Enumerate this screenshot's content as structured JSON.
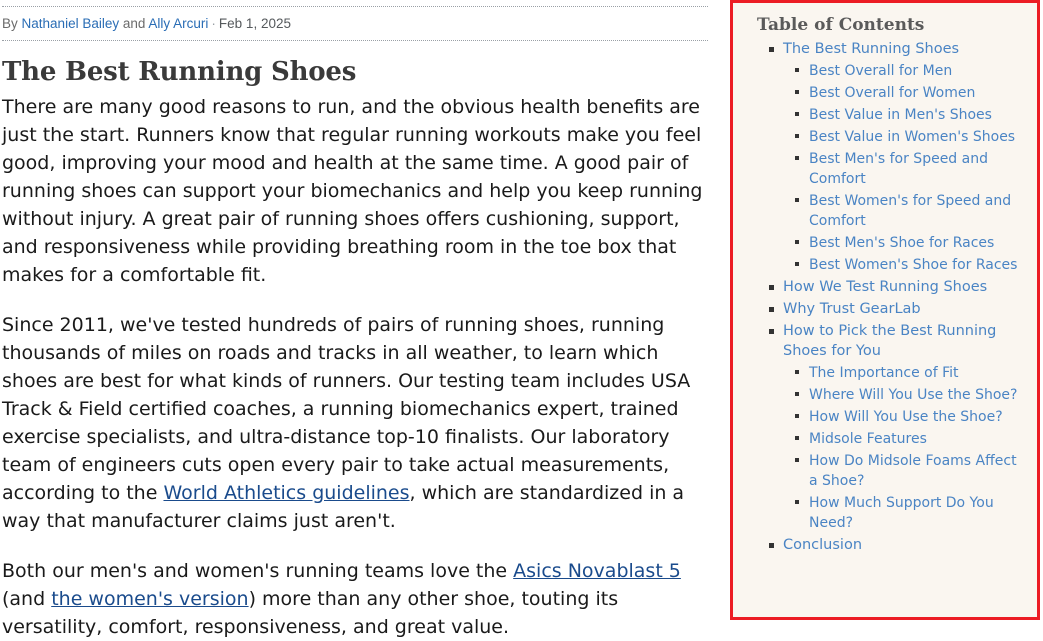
{
  "byline": {
    "prefix": "By",
    "author_one": "Nathaniel Bailey",
    "conjunction": "and",
    "author_two": "Ally Arcuri",
    "separator": "·",
    "date": "Feb 1, 2025"
  },
  "article": {
    "title": "The Best Running Shoes",
    "paragraphs": [
      {
        "segments": [
          {
            "type": "text",
            "value": "There are many good reasons to run, and the obvious health benefits are just the start. Runners know that regular running workouts make you feel good, improving your mood and health at the same time. A good pair of running shoes can support your biomechanics and help you keep running without injury. A great pair of running shoes offers cushioning, support, and responsiveness while providing breathing room in the toe box that makes for a comfortable fit."
          }
        ]
      },
      {
        "segments": [
          {
            "type": "text",
            "value": "Since 2011, we've tested hundreds of pairs of running shoes, running thousands of miles on roads and tracks in all weather, to learn which shoes are best for what kinds of runners. Our testing team includes USA Track & Field certified coaches, a running biomechanics expert, trained exercise specialists, and ultra-distance top-10 finalists. Our laboratory team of engineers cuts open every pair to take actual measurements, according to the "
          },
          {
            "type": "link",
            "value": "World Athletics guidelines"
          },
          {
            "type": "text",
            "value": ", which are standardized in a way that manufacturer claims just aren't."
          }
        ]
      },
      {
        "segments": [
          {
            "type": "text",
            "value": "Both our men's and women's running teams love the "
          },
          {
            "type": "link",
            "value": "Asics Novablast 5"
          },
          {
            "type": "text",
            "value": " (and "
          },
          {
            "type": "link",
            "value": "the women's version"
          },
          {
            "type": "text",
            "value": ") more than any other shoe, touting its versatility, comfort, responsiveness, and great value."
          }
        ]
      }
    ]
  },
  "toc": {
    "title": "Table of Contents",
    "items": [
      {
        "label": "The Best Running Shoes",
        "children": [
          {
            "label": "Best Overall for Men"
          },
          {
            "label": "Best Overall for Women"
          },
          {
            "label": "Best Value in Men's Shoes"
          },
          {
            "label": "Best Value in Women's Shoes"
          },
          {
            "label": "Best Men's for Speed and Comfort"
          },
          {
            "label": "Best Women's for Speed and Comfort"
          },
          {
            "label": "Best Men's Shoe for Races"
          },
          {
            "label": "Best Women's Shoe for Races"
          }
        ]
      },
      {
        "label": "How We Test Running Shoes",
        "children": []
      },
      {
        "label": "Why Trust GearLab",
        "children": []
      },
      {
        "label": "How to Pick the Best Running Shoes for You",
        "children": [
          {
            "label": "The Importance of Fit"
          },
          {
            "label": "Where Will You Use the Shoe?"
          },
          {
            "label": "How Will You Use the Shoe?"
          },
          {
            "label": "Midsole Features"
          },
          {
            "label": "How Do Midsole Foams Affect a Shoe?"
          },
          {
            "label": "How Much Support Do You Need?"
          }
        ]
      },
      {
        "label": "Conclusion",
        "children": []
      }
    ]
  },
  "colors": {
    "toc_border": "#ec1c24",
    "toc_background": "#faf6f0",
    "toc_link": "#4a84c4",
    "body_link": "#1a4b8c",
    "heading": "#3a3a3a",
    "body_text": "#1a1a1a"
  }
}
